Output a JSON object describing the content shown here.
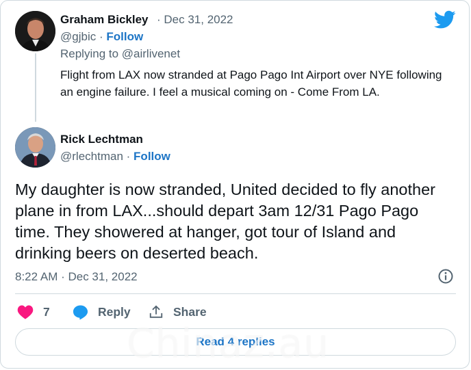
{
  "first_tweet": {
    "author_name": "Graham Bickley",
    "date": "· Dec 31, 2022",
    "handle": "@gjbic",
    "separator": "·",
    "follow_label": "Follow",
    "replying_to": "Replying to @airlivenet",
    "text": "Flight from LAX now stranded at Pago Pago Int Airport over NYE following an engine failure. I feel a musical coming on - Come From LA."
  },
  "reply_tweet": {
    "author_name": "Rick Lechtman",
    "handle": "@rlechtman",
    "separator": "·",
    "follow_label": "Follow",
    "text": "My daughter is now stranded, United decided to fly another plane in from LAX...should depart 3am 12/31 Pago Pago time. They showered at hanger, got tour of Island and drinking beers on deserted beach.",
    "timestamp": "8:22 AM · Dec 31, 2022"
  },
  "actions": {
    "like_count": "7",
    "reply_label": "Reply",
    "share_label": "Share"
  },
  "read_replies_label": "Read 4 replies",
  "watermark_text": "Chinaz.au",
  "colors": {
    "accent": "#1d9bf0",
    "link": "#1d75c6",
    "like": "#f91880",
    "muted": "#536471",
    "border": "#cfd9de"
  },
  "icons": [
    "twitter-bird-icon",
    "info-icon",
    "heart-icon",
    "reply-bubble-icon",
    "share-icon"
  ]
}
